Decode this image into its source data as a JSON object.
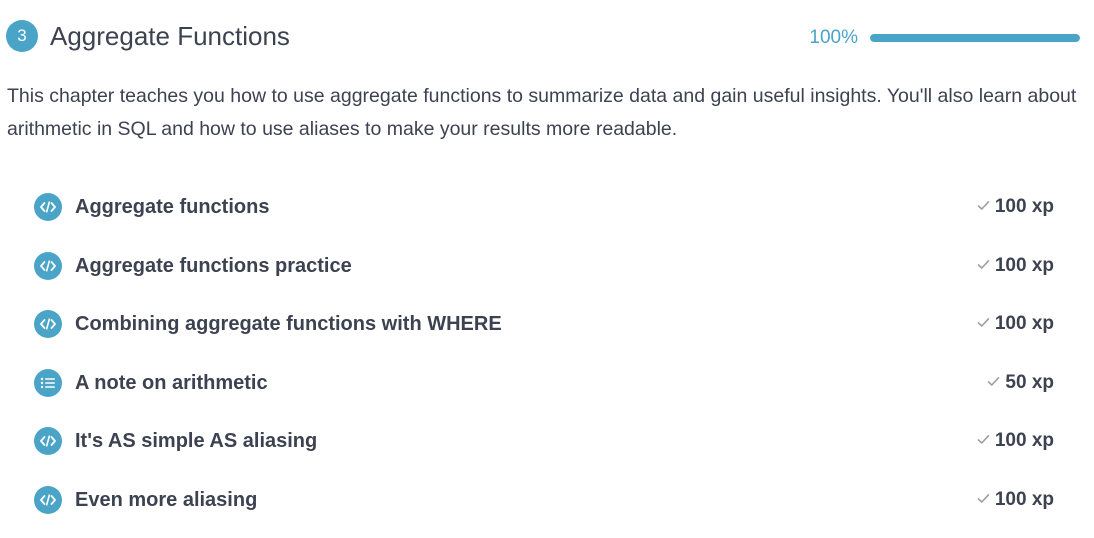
{
  "chapter": {
    "number": "3",
    "title": "Aggregate Functions",
    "progress_label": "100%",
    "progress_fraction": 1.0,
    "description": "This chapter teaches you how to use aggregate functions to summarize data and gain useful insights. You'll also learn about arithmetic in SQL and how to use aliases to make your results more readable."
  },
  "exercises": [
    {
      "title": "Aggregate functions",
      "xp": "100 xp",
      "icon": "code-icon",
      "completed": true
    },
    {
      "title": "Aggregate functions practice",
      "xp": "100 xp",
      "icon": "code-icon",
      "completed": true
    },
    {
      "title": "Combining aggregate functions with WHERE",
      "xp": "100 xp",
      "icon": "code-icon",
      "completed": true
    },
    {
      "title": "A note on arithmetic",
      "xp": "50 xp",
      "icon": "list-icon",
      "completed": true
    },
    {
      "title": "It's AS simple AS aliasing",
      "xp": "100 xp",
      "icon": "code-icon",
      "completed": true
    },
    {
      "title": "Even more aliasing",
      "xp": "100 xp",
      "icon": "code-icon",
      "completed": true
    }
  ],
  "colors": {
    "accent": "#4aa4c7",
    "text": "#3d4251",
    "track": "#dfe7ec",
    "check": "#9aa0a6"
  }
}
